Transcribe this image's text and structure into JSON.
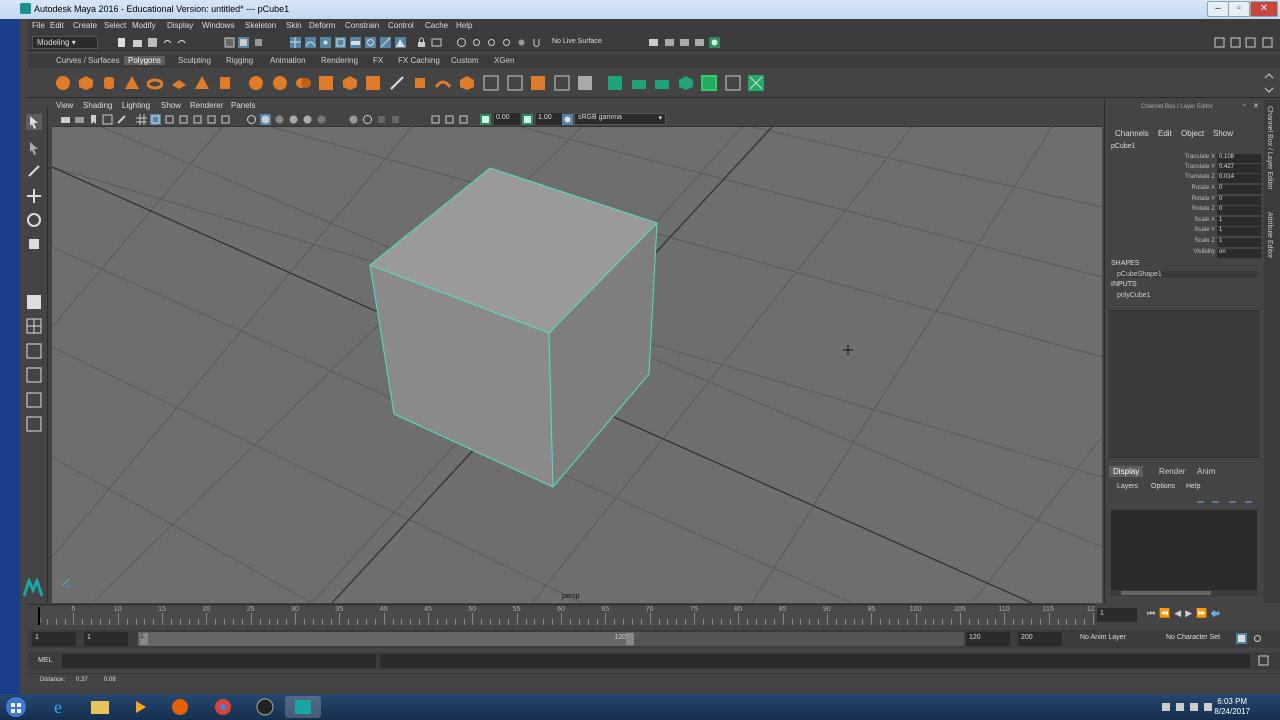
{
  "window": {
    "title": "Autodesk Maya 2016 - Educational Version: untitled*   ---   pCube1"
  },
  "menubar": [
    "File",
    "Edit",
    "Create",
    "Select",
    "Modify",
    "Display",
    "Windows",
    "Skeleton",
    "Skin",
    "Deform",
    "Constrain",
    "Control",
    "Cache",
    "Help"
  ],
  "statusline": {
    "mode": "Modeling",
    "live_surface": "No Live Surface"
  },
  "shelf_tabs": [
    "Curves / Surfaces",
    "Polygons",
    "Sculpting",
    "Rigging",
    "Animation",
    "Rendering",
    "FX",
    "FX Caching",
    "Custom",
    "XGen"
  ],
  "shelf_active": "Polygons",
  "viewport": {
    "menu": [
      "View",
      "Shading",
      "Lighting",
      "Show",
      "Renderer",
      "Panels"
    ],
    "exposure": "0.00",
    "gamma": "1.00",
    "color_space": "sRGB gamma",
    "camera_label": "persp"
  },
  "channel_box": {
    "title": "Channel Box / Layer Editor",
    "menu": [
      "Channels",
      "Edit",
      "Object",
      "Show"
    ],
    "object": "pCube1",
    "channels": [
      {
        "label": "Translate X",
        "value": "0.108"
      },
      {
        "label": "Translate Y",
        "value": "0.427"
      },
      {
        "label": "Translate Z",
        "value": "0.014"
      },
      {
        "label": "Rotate X",
        "value": "0"
      },
      {
        "label": "Rotate Y",
        "value": "0"
      },
      {
        "label": "Rotate Z",
        "value": "0"
      },
      {
        "label": "Scale X",
        "value": "1"
      },
      {
        "label": "Scale Y",
        "value": "1"
      },
      {
        "label": "Scale Z",
        "value": "1"
      },
      {
        "label": "Visibility",
        "value": "on"
      }
    ],
    "shapes_header": "SHAPES",
    "shape": "pCubeShape1",
    "inputs_header": "INPUTS",
    "input": "polyCube1",
    "layer_tabs": [
      "Display",
      "Render",
      "Anim"
    ],
    "layer_menu": [
      "Layers",
      "Options",
      "Help"
    ]
  },
  "side_tabs": [
    "Channel Box / Layer Editor",
    "Attribute Editor"
  ],
  "timeline": {
    "ticks": [
      "5",
      "10",
      "15",
      "20",
      "25",
      "30",
      "35",
      "40",
      "45",
      "50",
      "55",
      "60",
      "65",
      "70",
      "75",
      "80",
      "85",
      "90",
      "95",
      "100",
      "105",
      "110",
      "115",
      "120"
    ],
    "start_label": "1",
    "current_frame": "1"
  },
  "range": {
    "start": "1",
    "playback_start": "1",
    "slider_start": "1",
    "slider_end": "120",
    "playback_end": "120",
    "end": "200",
    "anim_layer": "No Anim Layer",
    "character_set": "No Character Set"
  },
  "mel": {
    "label": "MEL"
  },
  "help_line": {
    "label": "Distance:",
    "v1": "0.37",
    "v2": "0.08"
  },
  "clock": {
    "time": "6:03 PM",
    "date": "8/24/2017"
  }
}
